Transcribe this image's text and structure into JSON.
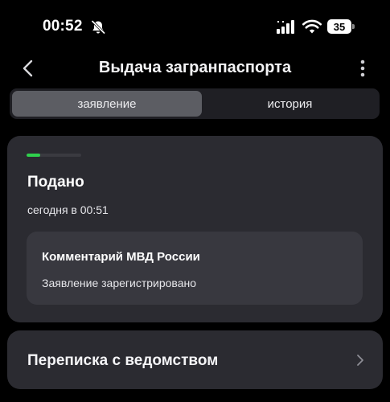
{
  "status_bar": {
    "time": "00:52",
    "battery": "35",
    "icons": [
      "bell-muted-icon",
      "signal-icon",
      "wifi-icon",
      "battery-icon"
    ]
  },
  "nav": {
    "title": "Выдача загранпаспорта",
    "icons": [
      "chevron-left-icon",
      "more-vertical-icon"
    ]
  },
  "tabs": [
    {
      "label": "заявление",
      "active": true
    },
    {
      "label": "история",
      "active": false
    }
  ],
  "status_card": {
    "progress": 0.25,
    "progress_color": "#2fd14d",
    "title": "Подано",
    "date": "сегодня в 00:51",
    "comment": {
      "title": "Комментарий МВД России",
      "text": "Заявление зарегистрировано"
    }
  },
  "correspondence": {
    "label": "Переписка с ведомством",
    "icon": "chevron-right-icon"
  }
}
